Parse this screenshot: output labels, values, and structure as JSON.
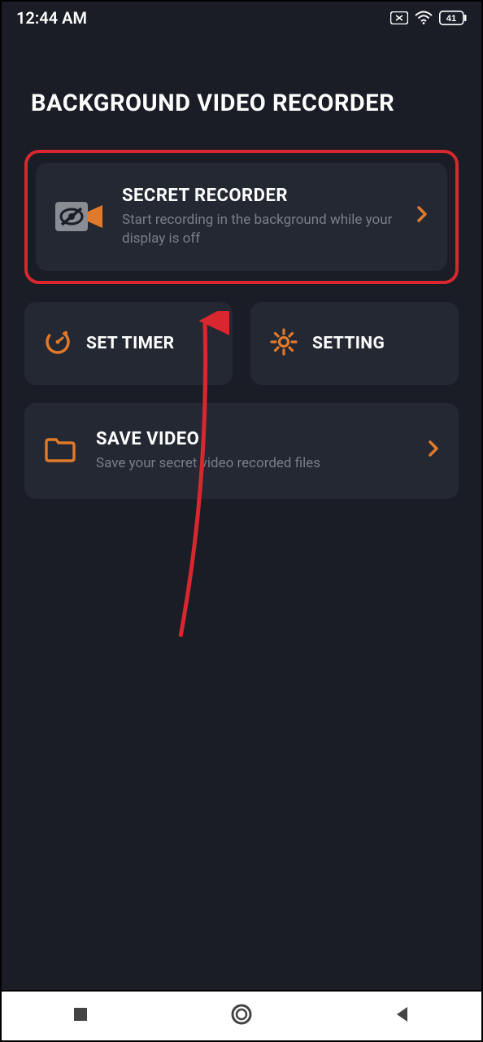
{
  "statusbar": {
    "time": "12:44 AM",
    "battery": "41"
  },
  "app": {
    "title": "BACKGROUND VIDEO RECORDER"
  },
  "cards": {
    "secret": {
      "title": "SECRET RECORDER",
      "subtitle": "Start recording in the background while your display is off"
    },
    "timer": {
      "label": "SET TIMER"
    },
    "setting": {
      "label": "SETTING"
    },
    "save": {
      "title": "SAVE VIDEO",
      "subtitle": "Save your secret video recorded files"
    }
  }
}
